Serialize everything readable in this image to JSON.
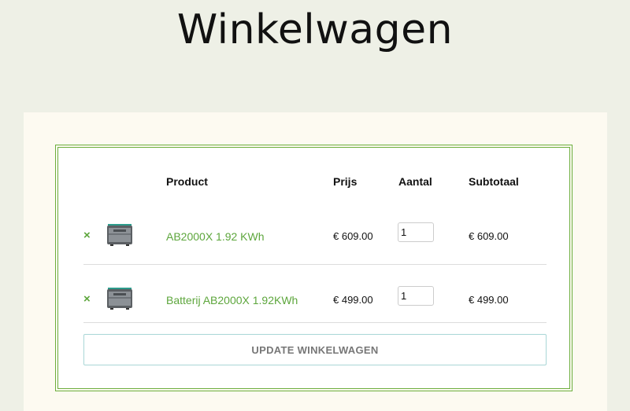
{
  "page": {
    "title": "Winkelwagen"
  },
  "cart": {
    "columns": {
      "product": "Product",
      "price": "Prijs",
      "quantity": "Aantal",
      "subtotal": "Subtotaal"
    },
    "remove_icon": "×",
    "items": [
      {
        "name": "AB2000X 1.92 KWh",
        "price": "€ 609.00",
        "quantity": "1",
        "subtotal": "€ 609.00",
        "thumb_icon": "battery-product-image"
      },
      {
        "name": "Batterij AB2000X 1.92KWh",
        "price": "€ 499.00",
        "quantity": "1",
        "subtotal": "€ 499.00",
        "thumb_icon": "battery-product-image"
      }
    ],
    "update_label": "UPDATE WINKELWAGEN"
  },
  "colors": {
    "accent": "#5da63c",
    "border": "#6dae3d",
    "background": "#eef0e6",
    "card": "#fdfaf1"
  }
}
